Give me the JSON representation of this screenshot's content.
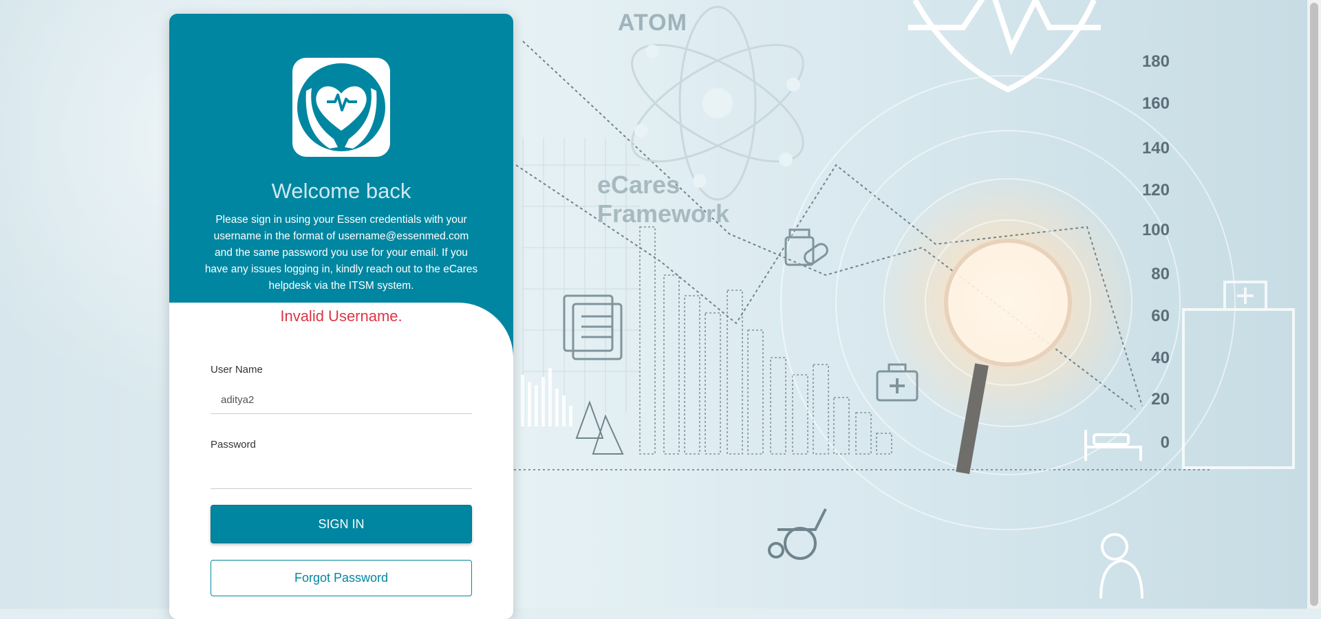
{
  "app": {
    "welcome_title": "Welcome back",
    "description": "Please sign in using your Essen credentials with your username in the format of username@essenmed.com and the same password you use for your email. If you have any issues logging in, kindly reach out to the eCares helpdesk via the ITSM system.",
    "logo_icon": "heart-hands-icon"
  },
  "form": {
    "error_message": "Invalid Username.",
    "username_label": "User Name",
    "username_value": "aditya2",
    "password_label": "Password",
    "password_value": "",
    "sign_in_label": "SIGN IN",
    "forgot_password_label": "Forgot Password"
  },
  "background": {
    "atom_title": "ATOM",
    "framework_line1": "eCares",
    "framework_line2": "Framework",
    "y_axis_labels": [
      "180",
      "160",
      "140",
      "120",
      "100",
      "80",
      "60",
      "40",
      "20",
      "0"
    ]
  },
  "colors": {
    "brand_teal": "#0086a1",
    "error_red": "#dc3545"
  }
}
